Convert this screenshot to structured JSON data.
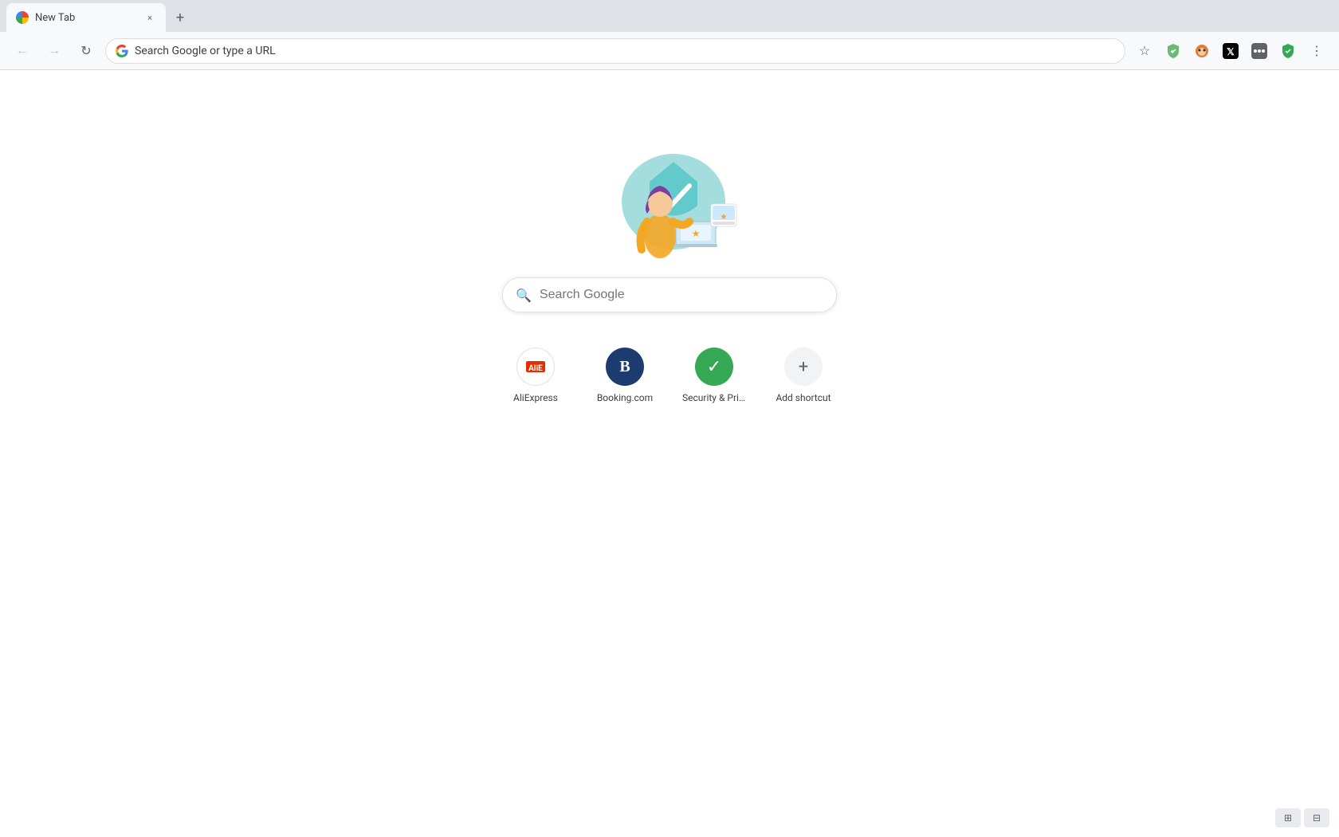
{
  "browser": {
    "tab": {
      "title": "New Tab",
      "close_label": "×"
    },
    "new_tab_label": "+",
    "nav": {
      "back_label": "←",
      "forward_label": "→",
      "refresh_label": "↻",
      "address_placeholder": "Search Google or type a URL"
    },
    "toolbar": {
      "bookmark_icon": "☆",
      "menu_icon": "⋮"
    }
  },
  "page": {
    "search_placeholder": "Search Google",
    "shortcuts": [
      {
        "id": "aliexpress",
        "label": "AliExpress",
        "icon_type": "aliexpress"
      },
      {
        "id": "booking",
        "label": "Booking.com",
        "icon_type": "booking"
      },
      {
        "id": "security",
        "label": "Security & Priv...",
        "icon_type": "security"
      },
      {
        "id": "add-shortcut",
        "label": "Add shortcut",
        "icon_type": "add"
      }
    ]
  },
  "bottom_buttons": {
    "customize_label": "⊞",
    "expand_label": "⊟"
  }
}
